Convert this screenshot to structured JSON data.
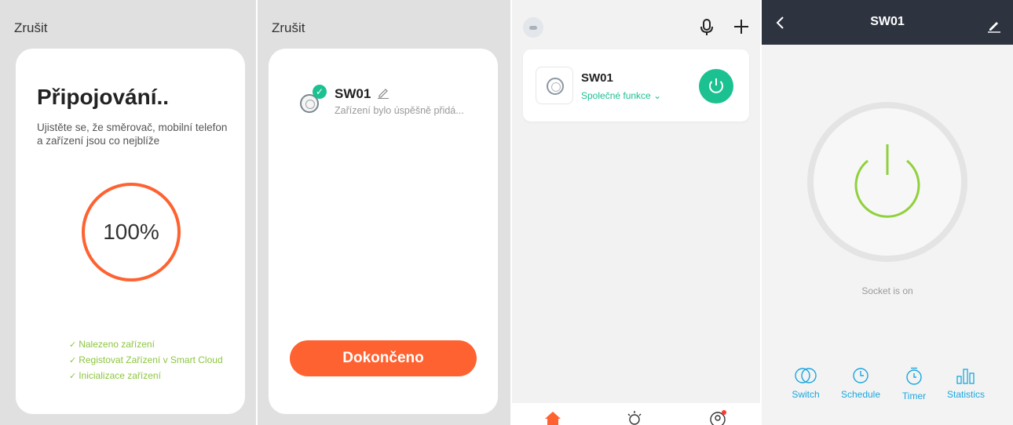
{
  "panel_connecting": {
    "cancel_label": "Zrušit",
    "title": "Připojování..",
    "description": "Ujistěte se, že směrovač, mobilní telefon a zařízení jsou co nejblíže",
    "progress": 1.0,
    "progress_text": "100%",
    "steps": [
      "Nalezeno zařízení",
      "Registovat Zařízení  v Smart Cloud",
      "Inicializace zařízení"
    ],
    "accent_color": "#ff6231",
    "step_color": "#8cc63f"
  },
  "panel_added": {
    "cancel_label": "Zrušit",
    "device_name": "SW01",
    "status_text": "Zařízení bylo úspěšně přidá...",
    "done_label": "Dokončeno",
    "button_color": "#ff6231"
  },
  "panel_home": {
    "device_name": "SW01",
    "device_functions": "Společné funkce",
    "power_color": "#1cc191",
    "tabs": [
      "home-icon",
      "scene-sun-icon",
      "profile-icon"
    ],
    "home_tab_color": "#ff6231"
  },
  "panel_device": {
    "title": "SW01",
    "status_text": "Socket is on",
    "power_ring_color": "#8fd13c",
    "actions": [
      {
        "label": "Switch",
        "icon": "switch-icon"
      },
      {
        "label": "Schedule",
        "icon": "schedule-icon"
      },
      {
        "label": "Timer",
        "icon": "timer-icon"
      },
      {
        "label": "Statistics",
        "icon": "statistics-icon"
      }
    ],
    "action_color": "#1aa7e0"
  }
}
